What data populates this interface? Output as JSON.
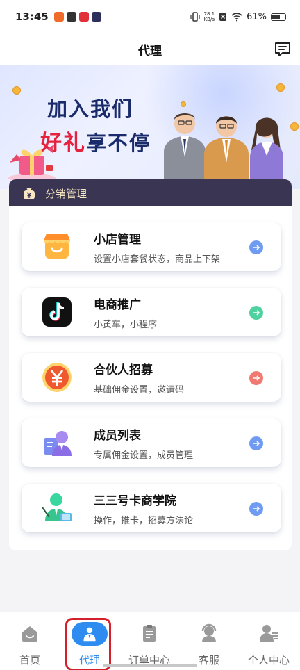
{
  "status_bar": {
    "time": "13:45",
    "net_speed_value": "78.1",
    "net_speed_unit": "KB/s",
    "battery": "61%"
  },
  "header": {
    "title": "代理",
    "message_icon": "message-icon"
  },
  "banner": {
    "line1": "加入我们",
    "line2_highlight": "好礼",
    "line2_rest": "享不停"
  },
  "panel": {
    "title": "分销管理",
    "icon": "money-bag-icon"
  },
  "menu": [
    {
      "title": "小店管理",
      "subtitle": "设置小店套餐状态，商品上下架",
      "icon": "shop-icon",
      "arrow_color": "#6f9cf2"
    },
    {
      "title": "电商推广",
      "subtitle": "小黄车，小程序",
      "icon": "tiktok-icon",
      "arrow_color": "#4fd1a0"
    },
    {
      "title": "合伙人招募",
      "subtitle": "基础佣金设置，邀请码",
      "icon": "yuan-coin-icon",
      "arrow_color": "#f07a72"
    },
    {
      "title": "成员列表",
      "subtitle": "专属佣金设置，成员管理",
      "icon": "member-icon",
      "arrow_color": "#6f9cf2"
    },
    {
      "title": "三三号卡商学院",
      "subtitle": "操作，推卡，招募方法论",
      "icon": "teacher-icon",
      "arrow_color": "#6f9cf2"
    }
  ],
  "bottom_nav": {
    "items": [
      {
        "label": "首页",
        "icon": "home-icon"
      },
      {
        "label": "代理",
        "icon": "agent-icon"
      },
      {
        "label": "订单中心",
        "icon": "order-icon"
      },
      {
        "label": "客服",
        "icon": "service-icon"
      },
      {
        "label": "个人中心",
        "icon": "profile-icon"
      }
    ],
    "active": "代理",
    "colors": {
      "active": "#2e8cf0",
      "inactive": "#666666",
      "highlight": "#d4202a"
    }
  }
}
